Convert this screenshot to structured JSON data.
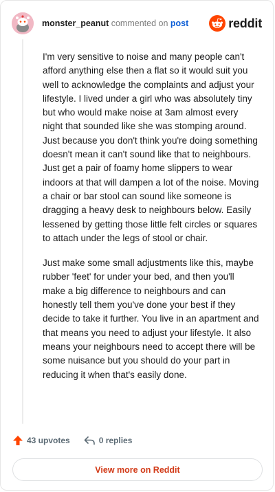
{
  "header": {
    "username": "monster_peanut",
    "commented_text": "commented on",
    "post_link": "post",
    "brand_name": "reddit"
  },
  "comment": {
    "paragraphs": [
      "I'm very sensitive to noise and many people can't afford anything else then a flat so it would suit you well to acknowledge the complaints and adjust your lifestyle. I lived under a girl who was absolutely tiny but who would make noise at 3am almost every night that sounded like she was stomping around. Just because you don't think you're doing something doesn't mean it can't sound like that to neighbours. Just get a pair of foamy home slippers to wear indoors at that will dampen a lot of the noise. Moving a chair or bar stool can sound like someone is dragging a heavy desk to neighbours below. Easily lessened by getting those little felt circles or squares to attach under the legs of stool or chair.",
      "Just make some small adjustments like this, maybe rubber 'feet' for under your bed, and then you'll make a big difference to neighbours and can honestly tell them you've done your best if they decide to take it further. You live in an apartment and that means you need to adjust your lifestyle. It also means your neighbours need to accept there will be some nuisance but you should do your part in reducing it when that's easily done."
    ]
  },
  "actions": {
    "upvotes": "43 upvotes",
    "replies": "0 replies"
  },
  "footer": {
    "view_more": "View more on Reddit"
  },
  "colors": {
    "brand": "#ff4500",
    "upvote": "#ff4500",
    "link": "#0b5dd6",
    "view_more": "#d23a17"
  },
  "icons": [
    "snoo-avatar-icon",
    "reddit-logo-icon",
    "upvote-arrow-icon",
    "reply-arrow-icon"
  ]
}
